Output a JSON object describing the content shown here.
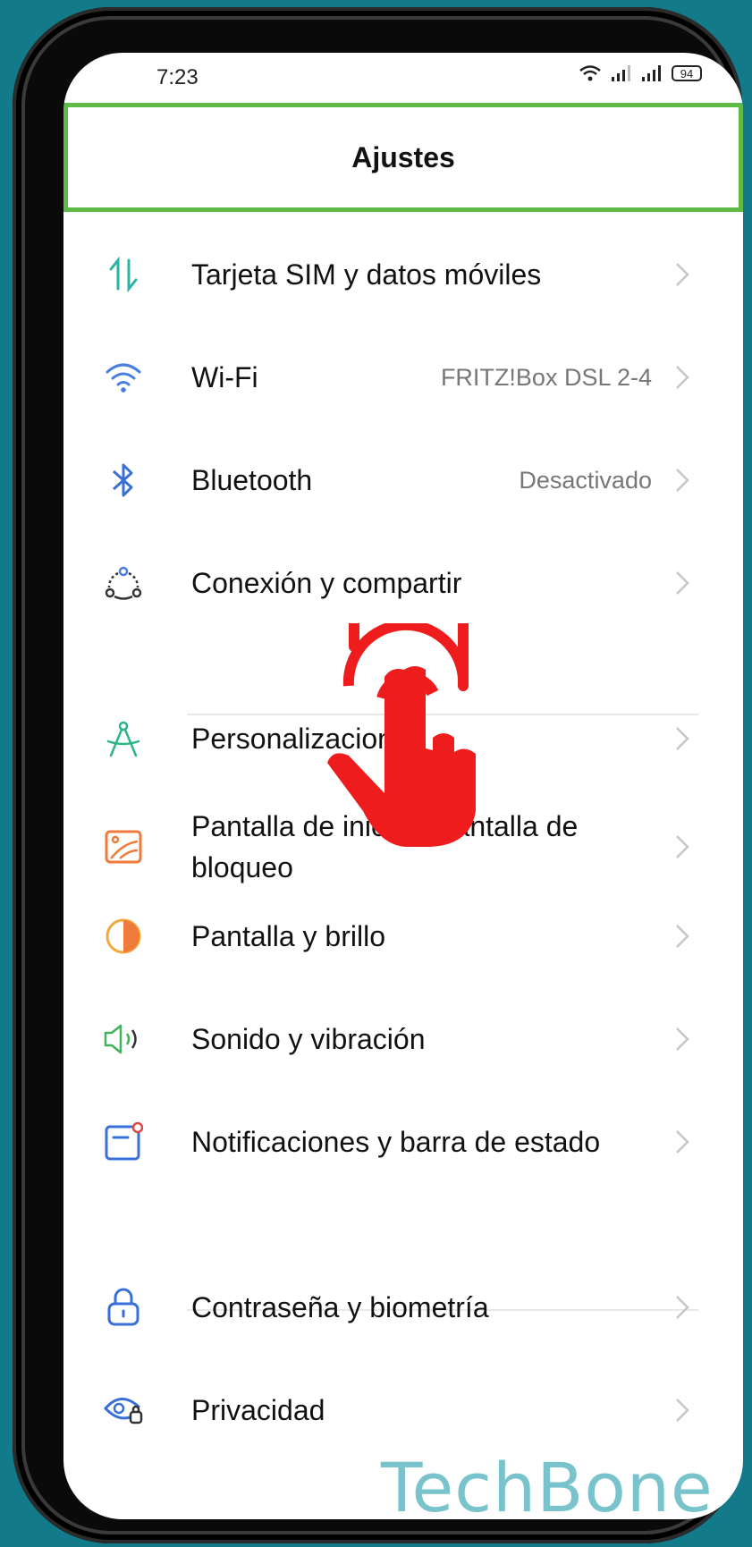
{
  "status_bar": {
    "time": "7:23",
    "battery": "94"
  },
  "header": {
    "title": "Ajustes"
  },
  "items": [
    {
      "label": "Tarjeta SIM y datos móviles",
      "value": ""
    },
    {
      "label": "Wi-Fi",
      "value": "FRITZ!Box DSL 2-4"
    },
    {
      "label": "Bluetooth",
      "value": "Desactivado"
    },
    {
      "label": "Conexión y compartir",
      "value": ""
    },
    {
      "label": "Personalizaciones",
      "value": ""
    },
    {
      "label": "Pantalla de inicio y pantalla de bloqueo",
      "value": ""
    },
    {
      "label": "Pantalla y brillo",
      "value": ""
    },
    {
      "label": "Sonido y vibración",
      "value": ""
    },
    {
      "label": "Notificaciones y barra de estado",
      "value": ""
    },
    {
      "label": "Contraseña y biometría",
      "value": ""
    },
    {
      "label": "Privacidad",
      "value": ""
    }
  ],
  "icons": [
    "data-arrows-icon",
    "wifi-icon",
    "bluetooth-icon",
    "connection-share-icon",
    "personalization-icon",
    "wallpaper-icon",
    "brightness-icon",
    "sound-icon",
    "notifications-icon",
    "lock-icon",
    "privacy-icon"
  ],
  "colors": {
    "accent_header_border": "#5dbb46",
    "tap_hand": "#ee1c1c",
    "background": "#137a8a"
  },
  "watermark": "TechBone"
}
